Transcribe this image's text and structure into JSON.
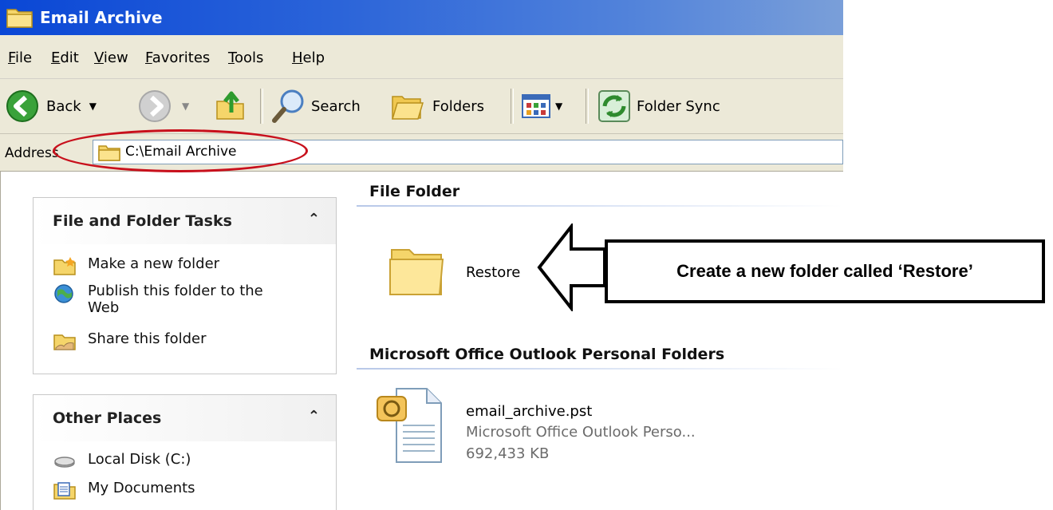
{
  "window": {
    "title": "Email Archive"
  },
  "menu": [
    "File",
    "Edit",
    "View",
    "Favorites",
    "Tools",
    "Help"
  ],
  "toolbar": {
    "back": "Back",
    "search": "Search",
    "folders": "Folders",
    "sync": "Folder Sync"
  },
  "address": {
    "label": "Address",
    "path": "C:\\Email Archive"
  },
  "left_panel": {
    "tasks_title": "File and Folder Tasks",
    "tasks": [
      {
        "label": "Make a new folder",
        "icon": "new-folder-icon"
      },
      {
        "label": "Publish this folder to the Web",
        "icon": "publish-web-icon"
      },
      {
        "label": "Share this folder",
        "icon": "share-folder-icon"
      }
    ],
    "places_title": "Other Places",
    "places": [
      {
        "label": "Local Disk (C:)",
        "icon": "disk-icon"
      },
      {
        "label": "My Documents",
        "icon": "my-documents-icon"
      }
    ]
  },
  "content": {
    "group1": "File Folder",
    "folder_name": "Restore",
    "group2": "Microsoft Office Outlook Personal Folders",
    "file": {
      "name": "email_archive.pst",
      "type": "Microsoft Office Outlook Perso...",
      "size": "692,433 KB"
    }
  },
  "callout": "Create a new folder called ‘Restore’",
  "colors": {
    "title_blue": "#0a47d6",
    "chrome": "#ece9d8",
    "highlight_red": "#c8101c"
  }
}
